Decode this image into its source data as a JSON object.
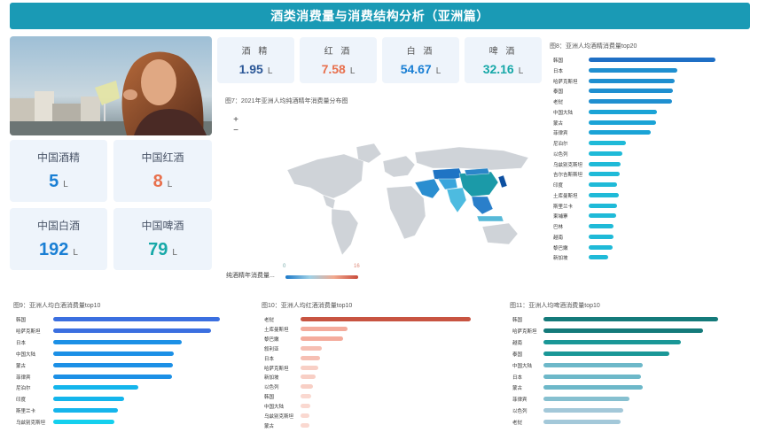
{
  "title": "酒类消费量与消费结构分析（亚洲篇）",
  "china_tiles": [
    {
      "label": "中国酒精",
      "value": "5",
      "unit": "L",
      "color": "#1a7fd4"
    },
    {
      "label": "中国红酒",
      "value": "8",
      "unit": "L",
      "color": "#e8704d"
    },
    {
      "label": "中国白酒",
      "value": "192",
      "unit": "L",
      "color": "#1a7fd4"
    },
    {
      "label": "中国啤酒",
      "value": "79",
      "unit": "L",
      "color": "#17a8a8"
    }
  ],
  "asia_stats": [
    {
      "label": "酒 精",
      "value": "1.95",
      "unit": "L",
      "color": "#2b5797"
    },
    {
      "label": "红 酒",
      "value": "7.58",
      "unit": "L",
      "color": "#e8704d"
    },
    {
      "label": "白 酒",
      "value": "54.67",
      "unit": "L",
      "color": "#1a7fd4"
    },
    {
      "label": "啤 酒",
      "value": "32.16",
      "unit": "L",
      "color": "#17a8a8"
    }
  ],
  "map": {
    "title": "图7：2021年亚洲人均纯酒精年消费量分布图",
    "zoom_in": "+",
    "zoom_out": "−",
    "legend_label": "纯酒精年消费量...",
    "legend_min": "0",
    "legend_max": "16"
  },
  "chart_data": [
    {
      "type": "bar",
      "title": "图8：亚洲人均酒精消费量top20",
      "categories": [
        "韩国",
        "日本",
        "哈萨克斯坦",
        "泰国",
        "老挝",
        "中国大陆",
        "蒙古",
        "菲律宾",
        "尼泊尔",
        "以色列",
        "乌兹别克斯坦",
        "吉尔吉斯斯坦",
        "印度",
        "土库曼斯坦",
        "斯里兰卡",
        "柬埔寨",
        "巴林",
        "越南",
        "黎巴嫩",
        "新加坡"
      ],
      "values": [
        10.2,
        7.1,
        6.9,
        6.8,
        6.7,
        5.5,
        5.4,
        5.0,
        3.0,
        2.7,
        2.6,
        2.5,
        2.3,
        2.4,
        2.3,
        2.2,
        2.0,
        2.0,
        1.9,
        1.6
      ],
      "colors": [
        "#1f6fc5",
        "#1f8fd0",
        "#1f8fd0",
        "#1f8fd0",
        "#1f8fd0",
        "#1aa3d6",
        "#1aa3d6",
        "#1aa3d6",
        "#1fbad8",
        "#1fbad8",
        "#1fbad8",
        "#1fbad8",
        "#1fbad8",
        "#1fbad8",
        "#1fbad8",
        "#1fbad8",
        "#1fbad8",
        "#1fbad8",
        "#1fbad8",
        "#1fbad8"
      ]
    },
    {
      "type": "bar",
      "title": "图9：亚洲人均白酒消费量top10",
      "categories": [
        "韩国",
        "哈萨克斯坦",
        "日本",
        "中国大陆",
        "蒙古",
        "菲律宾",
        "尼泊尔",
        "印度",
        "斯里兰卡",
        "乌兹别克斯坦"
      ],
      "values": [
        192,
        182,
        148,
        139,
        138,
        137,
        98,
        82,
        75,
        70
      ],
      "colors": [
        "#3b6fe0",
        "#3b6fe0",
        "#1c90e6",
        "#1c90e6",
        "#1c90e6",
        "#1c90e6",
        "#14b5ec",
        "#14b5ec",
        "#14b5ec",
        "#14d0ee"
      ]
    },
    {
      "type": "bar",
      "title": "图10：亚洲人均红酒消费量top10",
      "categories": [
        "老挝",
        "土库曼斯坦",
        "黎巴嫩",
        "叙利亚",
        "日本",
        "哈萨克斯坦",
        "新加坡",
        "以色列",
        "韩国",
        "中国大陆",
        "乌兹别克斯坦",
        "蒙古"
      ],
      "values": [
        8,
        2.2,
        2.0,
        1.0,
        0.9,
        0.85,
        0.7,
        0.6,
        0.5,
        0.45,
        0.42,
        0.4
      ],
      "colors": [
        "#c85441",
        "#f4ab9c",
        "#f4ab9c",
        "#f6bfb3",
        "#f6bfb3",
        "#f8cfc5",
        "#f8cfc5",
        "#f8cfc5",
        "#fad8d0",
        "#fad8d0",
        "#fad8d0",
        "#fad8d0"
      ]
    },
    {
      "type": "bar",
      "title": "图11：亚洲人均啤酒消费量top10",
      "categories": [
        "韩国",
        "哈萨克斯坦",
        "越南",
        "泰国",
        "中国大陆",
        "日本",
        "蒙古",
        "菲律宾",
        "以色列",
        "老挝"
      ],
      "values": [
        79,
        72,
        62,
        57,
        45,
        44,
        45,
        39,
        36,
        35
      ],
      "colors": [
        "#147a7a",
        "#147a7a",
        "#1a9797",
        "#1a9797",
        "#6db8c9",
        "#6db8c9",
        "#6db8c9",
        "#86c0d0",
        "#a3c8d9",
        "#a3c8d9"
      ]
    }
  ]
}
